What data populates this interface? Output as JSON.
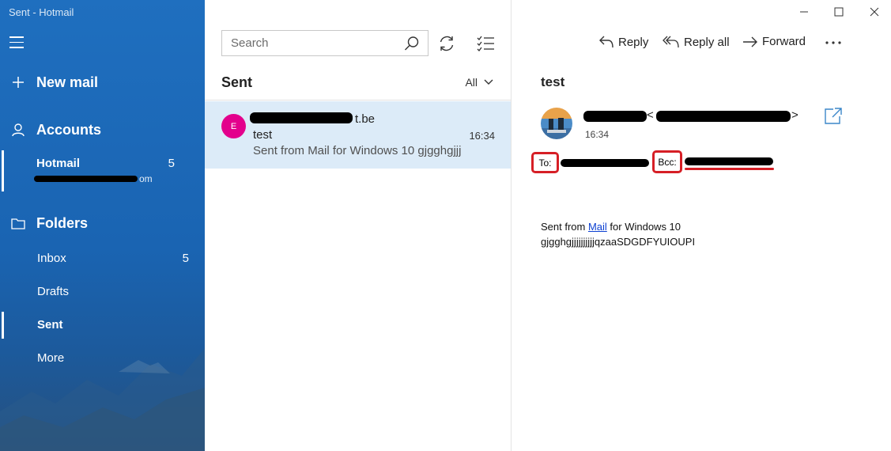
{
  "window": {
    "title": "Sent - Hotmail"
  },
  "sidebar": {
    "new_mail_label": "New mail",
    "accounts_label": "Accounts",
    "account": {
      "name": "Hotmail",
      "count": "5",
      "email_visible": "om"
    },
    "folders_label": "Folders",
    "folders": [
      {
        "name": "Inbox",
        "count": "5"
      },
      {
        "name": "Drafts",
        "count": ""
      },
      {
        "name": "Sent",
        "count": ""
      },
      {
        "name": "More",
        "count": ""
      }
    ],
    "selected_folder": "Sent"
  },
  "list": {
    "search_placeholder": "Search",
    "title": "Sent",
    "filter_label": "All",
    "messages": [
      {
        "avatar_letter": "E",
        "avatar_color": "#e3008c",
        "from_visible": "t.be",
        "subject": "test",
        "time": "16:34",
        "preview": "Sent from Mail for Windows 10 gjgghgjjj"
      }
    ]
  },
  "reading": {
    "toolbar": {
      "reply": "Reply",
      "reply_all": "Reply all",
      "forward": "Forward"
    },
    "subject": "test",
    "sender_open": "<",
    "sender_close": ">",
    "time": "16:34",
    "to_label": "To:",
    "bcc_label": "Bcc:",
    "body": {
      "line1_prefix": "Sent from ",
      "link": "Mail",
      "line1_suffix": " for Windows 10",
      "line2": "gjgghgjjjjjjjjjjqzaaSDGDFYUIOUPI"
    }
  },
  "colors": {
    "sidebar": "#1a64b2",
    "selected_item": "#dcebf8",
    "highlight": "#d61f26",
    "link": "#0b3fd1"
  }
}
